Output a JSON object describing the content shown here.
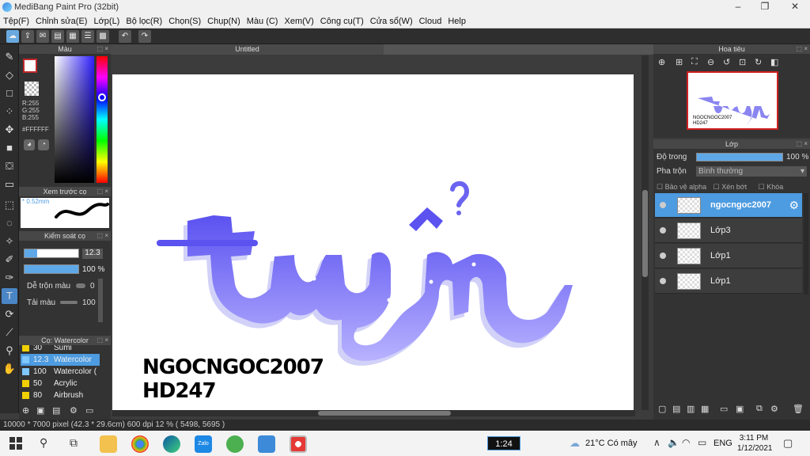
{
  "window": {
    "title": "MediBang Paint Pro (32bit)"
  },
  "menu": [
    "Tệp(F)",
    "Chỉnh sửa(E)",
    "Lớp(L)",
    "Bộ lọc(R)",
    "Chọn(S)",
    "Chụp(N)",
    "Màu (C)",
    "Xem(V)",
    "Công cụ(T)",
    "Cửa sổ(W)",
    "Cloud",
    "Help"
  ],
  "color_panel": {
    "title": "Màu",
    "r": "R:255",
    "g": "G:255",
    "b": "B:255",
    "hex": "#FFFFFF"
  },
  "brush_preview": {
    "title": "Xem trước cọ",
    "size": "0.52mm"
  },
  "brush_control": {
    "title": "Kiểm soát cọ",
    "size_value": "12.3",
    "opacity_value": "100 %",
    "blend_label": "Dễ trộn màu",
    "blend_value": "0",
    "paint_label": "Tải màu",
    "paint_value": "100"
  },
  "brush_list": {
    "title": "Cọ: Watercolor",
    "items": [
      {
        "size": "30",
        "name": "Sumi",
        "color": "#f0d000"
      },
      {
        "size": "12.3",
        "name": "Watercolor",
        "color": "#7ec8ff"
      },
      {
        "size": "100",
        "name": "Watercolor (",
        "color": "#7ec8ff"
      },
      {
        "size": "50",
        "name": "Acrylic",
        "color": "#f0d000"
      },
      {
        "size": "80",
        "name": "Airbrush",
        "color": "#f0d000"
      }
    ]
  },
  "document": {
    "tab": "Untitled"
  },
  "artwork": {
    "caption_line1": "NGOCNGOC2007",
    "caption_line2": "HD247"
  },
  "navigator": {
    "title": "Hoa tiêu"
  },
  "layers": {
    "title": "Lớp",
    "opacity_label": "Độ trong",
    "opacity_value": "100 %",
    "blend_label": "Pha trộn",
    "blend_value": "Bình thường",
    "protect_alpha": "Bảo vệ alpha",
    "clip": "Xén bớt",
    "lock": "Khóa",
    "items": [
      {
        "name": "ngocngoc2007",
        "selected": true
      },
      {
        "name": "Lớp3",
        "selected": false
      },
      {
        "name": "Lớp1",
        "selected": false
      },
      {
        "name": "Lớp1",
        "selected": false
      }
    ]
  },
  "status": {
    "text": "10000 * 7000 pixel  (42.3 * 29.6cm)  600 dpi  12 %  ( 5498, 5695 )"
  },
  "taskbar": {
    "video_time": "1:24",
    "weather": "21°C  Có mây",
    "lang": "ENG",
    "time": "3:11 PM",
    "date": "1/12/2021"
  },
  "colors": {
    "accent": "#4d9be0",
    "panel": "#333333",
    "lettering": "#7b78f0"
  }
}
